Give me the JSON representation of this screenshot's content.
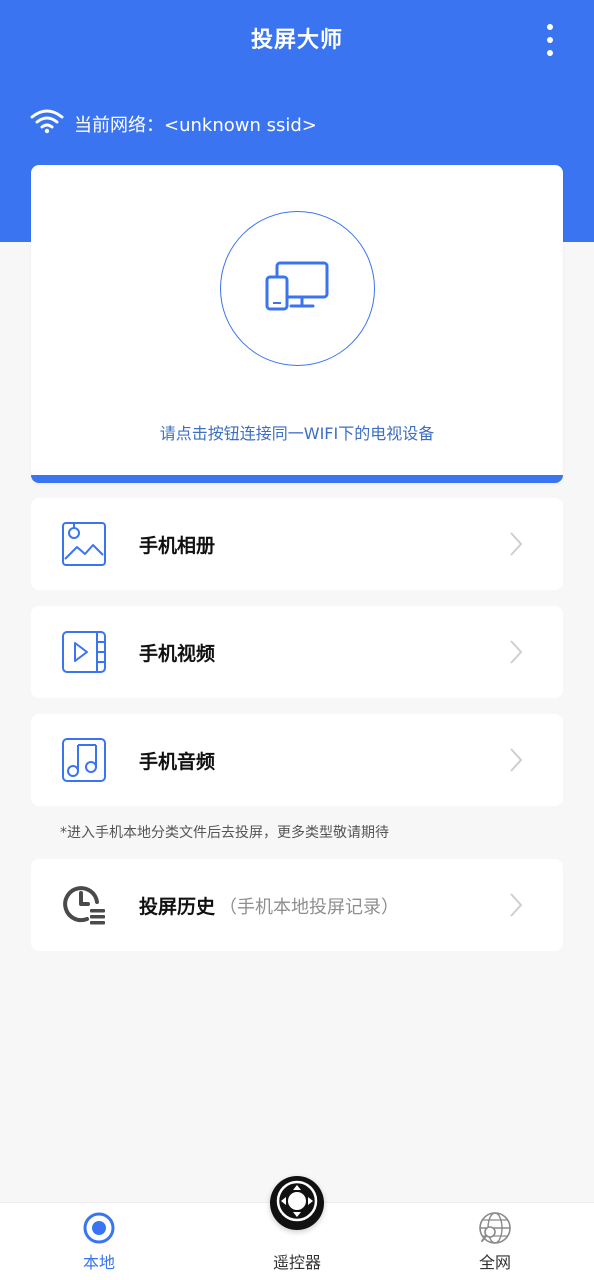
{
  "header": {
    "title": "投屏大师",
    "network_label": "当前网络：<unknown ssid>",
    "menu_icon": "more-vertical-icon",
    "wifi_icon": "wifi-icon",
    "accent_color": "#3a74f1"
  },
  "connect": {
    "icon": "devices-icon",
    "tip": "请点击按钮连接同一WIFI下的电视设备"
  },
  "menu": {
    "items": [
      {
        "label": "手机相册",
        "icon": "photo-icon"
      },
      {
        "label": "手机视频",
        "icon": "video-icon"
      },
      {
        "label": "手机音频",
        "icon": "music-icon"
      }
    ],
    "hint": "*进入手机本地分类文件后去投屏，更多类型敬请期待",
    "history": {
      "label": "投屏历史",
      "sub": "（手机本地投屏记录）",
      "icon": "history-clock-icon"
    }
  },
  "bottom_nav": {
    "items": [
      {
        "label": "本地",
        "icon": "local-target-icon",
        "active": true
      },
      {
        "label": "遥控器",
        "icon": "remote-dpad-icon",
        "active": false
      },
      {
        "label": "全网",
        "icon": "globe-search-icon",
        "active": false
      }
    ]
  }
}
